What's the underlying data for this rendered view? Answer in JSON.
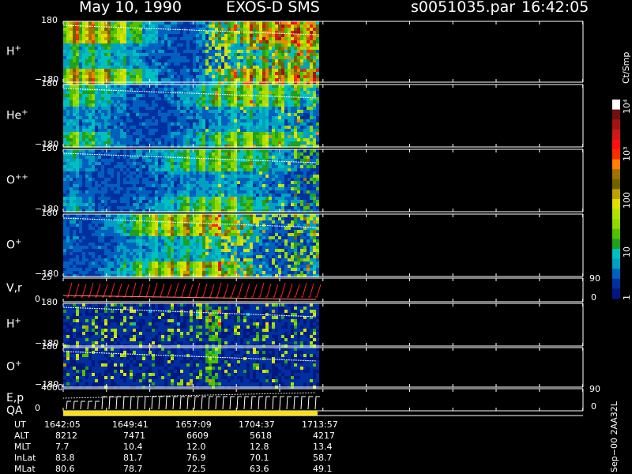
{
  "header": {
    "date": "May 10, 1990",
    "instrument": "EXOS-D SMS",
    "file": "s0051035.par",
    "time": "16:42:05"
  },
  "colorbar": {
    "unit": "Ct/Smp",
    "labels": [
      "10⁴",
      "10³",
      "100",
      "10",
      "1"
    ],
    "colors": [
      "#ffffff",
      "#701010",
      "#a01414",
      "#d01818",
      "#ff1010",
      "#ff2c00",
      "#ff8000",
      "#a07000",
      "#706000",
      "#c0a000",
      "#e0e000",
      "#b0e000",
      "#90d800",
      "#50c000",
      "#20a020",
      "#00c0c0",
      "#00a0c0",
      "#0060c0",
      "#0030a0",
      "#001880"
    ]
  },
  "panels": [
    {
      "id": "h-plus-1",
      "label": "H",
      "sup": "+",
      "ymax": "180",
      "ymin": "−180",
      "kind": "pitch",
      "seed": 1,
      "activity": 0.75,
      "red": 0.35
    },
    {
      "id": "he-plus",
      "label": "He",
      "sup": "+",
      "ymax": "180",
      "ymin": "−180",
      "kind": "pitch",
      "seed": 2,
      "activity": 0.45,
      "red": 0.05
    },
    {
      "id": "o-plusplus",
      "label": "O",
      "sup": "++",
      "ymax": "180",
      "ymin": "−180",
      "kind": "pitch",
      "seed": 3,
      "activity": 0.4,
      "red": 0.05
    },
    {
      "id": "o-plus-1",
      "label": "O",
      "sup": "+",
      "ymax": "180",
      "ymin": "−180",
      "kind": "pitch",
      "seed": 4,
      "activity": 0.65,
      "red": 0.25
    },
    {
      "id": "vr",
      "label": "V,r",
      "sup": "",
      "ymax": "25",
      "ymin": "0",
      "rightTop": "90",
      "rightBottom": "0",
      "kind": "vr"
    },
    {
      "id": "h-plus-2",
      "label": "H",
      "sup": "+",
      "ymax": "180",
      "ymin": "−180",
      "kind": "sparse",
      "seed": 5,
      "activity": 0.3,
      "red": 0.02
    },
    {
      "id": "o-plus-2",
      "label": "O",
      "sup": "+",
      "ymax": "180",
      "ymin": "−180",
      "kind": "sparse",
      "seed": 6,
      "activity": 0.15,
      "red": 0.0
    },
    {
      "id": "ep",
      "label": "E,p",
      "sup": "",
      "ymax": "4000",
      "ymin": "0",
      "rightTop": "90",
      "rightBottom": "0",
      "kind": "ep"
    },
    {
      "id": "qa",
      "label": "QA",
      "sup": "",
      "kind": "qa"
    }
  ],
  "time_axis": {
    "rows": [
      {
        "name": "UT",
        "values": [
          "1642:05",
          "1649:41",
          "1657:09",
          "1704:37",
          "1713:57"
        ]
      },
      {
        "name": "ALT",
        "values": [
          "8212",
          "7471",
          "6609",
          "5618",
          "4217"
        ]
      },
      {
        "name": "MLT",
        "values": [
          "7.7",
          "10.4",
          "12.0",
          "12.8",
          "13.4"
        ]
      },
      {
        "name": "InLat",
        "values": [
          "83.8",
          "81.7",
          "76.9",
          "70.1",
          "58.7"
        ]
      },
      {
        "name": "MLat",
        "values": [
          "80.6",
          "78.7",
          "72.5",
          "63.6",
          "49.1"
        ]
      }
    ]
  },
  "footer_vertical": "Sep−00  2AA32L",
  "chart_data": {
    "type": "heatmap",
    "title": "May 10, 1990  EXOS-D SMS  s0051035.par  16:42:05",
    "x_ticks_ut": [
      "1642:05",
      "1649:41",
      "1657:09",
      "1704:37",
      "1713:57"
    ],
    "panels": [
      {
        "name": "H+",
        "ylim": [
          -180,
          180
        ]
      },
      {
        "name": "He+",
        "ylim": [
          -180,
          180
        ]
      },
      {
        "name": "O++",
        "ylim": [
          -180,
          180
        ]
      },
      {
        "name": "O+",
        "ylim": [
          -180,
          180
        ]
      },
      {
        "name": "V,r",
        "ylim": [
          0,
          25
        ],
        "right_ylim": [
          0,
          90
        ]
      },
      {
        "name": "H+",
        "ylim": [
          -180,
          180
        ]
      },
      {
        "name": "O+",
        "ylim": [
          -180,
          180
        ]
      },
      {
        "name": "E,p",
        "ylim": [
          0,
          4000
        ],
        "right_ylim": [
          0,
          90
        ]
      },
      {
        "name": "QA"
      }
    ],
    "colorbar": {
      "unit": "Ct/Smp",
      "scale": "log",
      "range": [
        1,
        10000
      ]
    }
  }
}
